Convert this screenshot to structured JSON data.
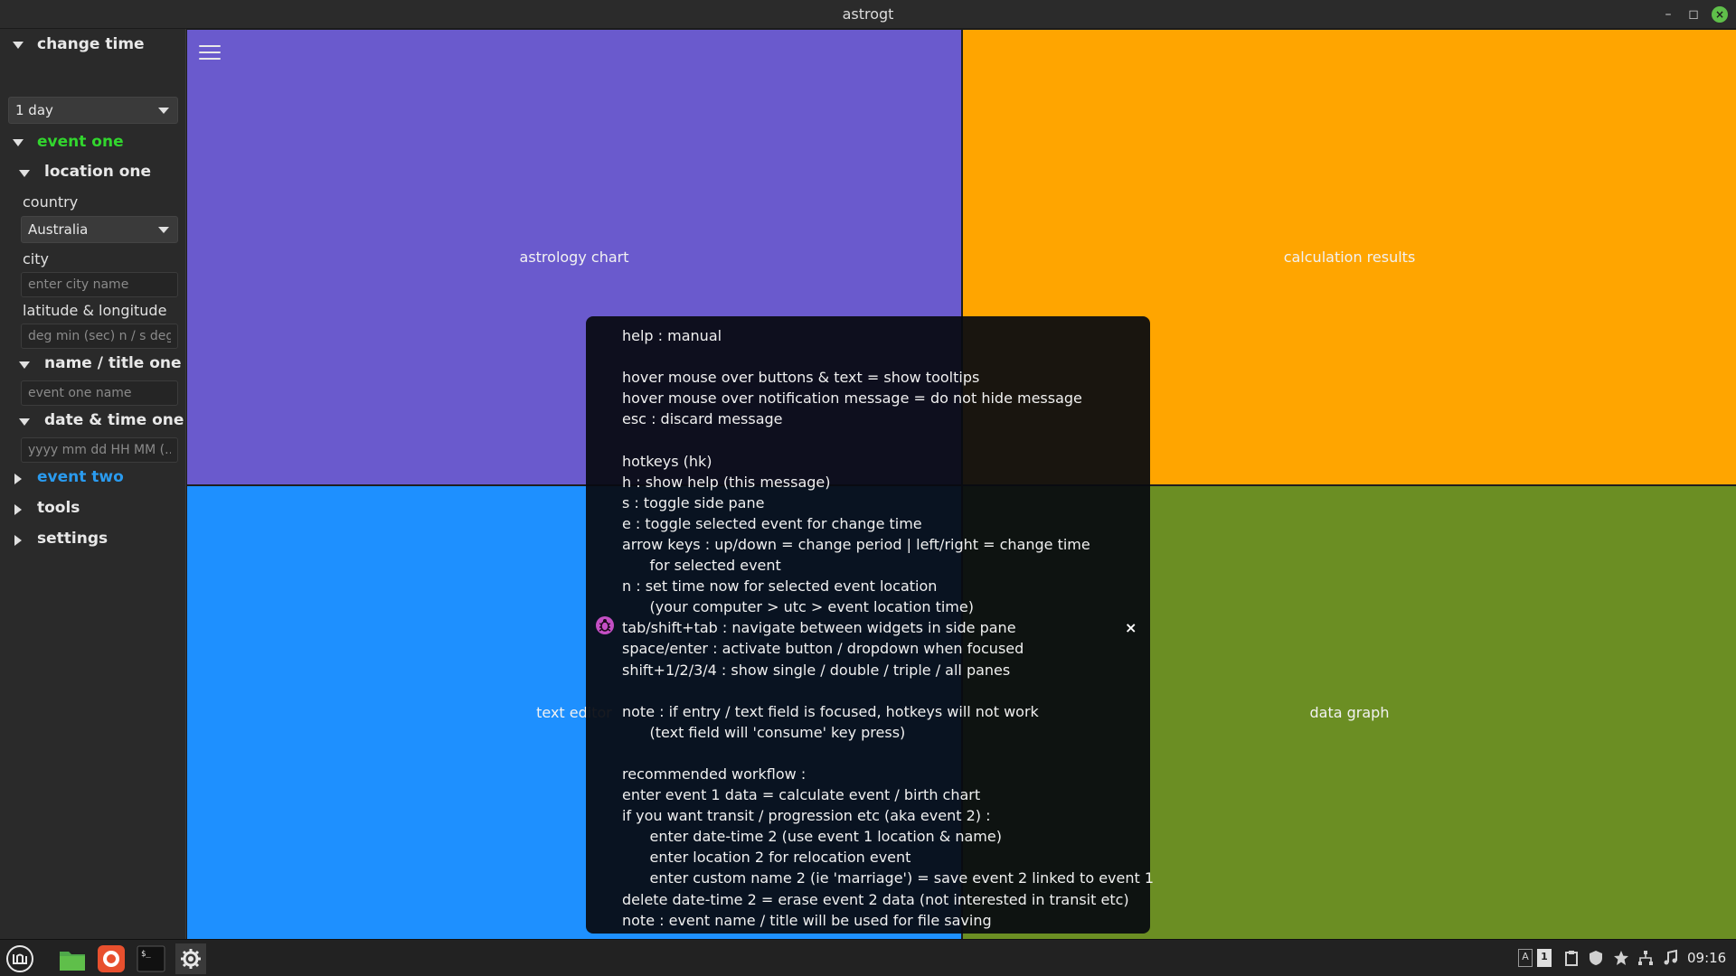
{
  "window": {
    "title": "astrogt"
  },
  "sidepane": {
    "change_time": {
      "header": "change time",
      "buttons": [
        "back-icon",
        "forward-icon",
        "now-clock-icon",
        "period-up-icon",
        "period-down-icon"
      ],
      "period": "1 day"
    },
    "event_one": {
      "header": "event one",
      "color": "#32d62e",
      "location": {
        "header": "location one",
        "country_label": "country",
        "country_value": "Australia",
        "city_label": "city",
        "city_placeholder": "enter city name",
        "latlong_label": "latitude & longitude",
        "latlong_placeholder": "deg min (sec) n / s deg..."
      },
      "name": {
        "header": "name / title one",
        "placeholder": "event one name"
      },
      "datetime": {
        "header": "date & time one",
        "placeholder": "yyyy mm dd HH MM (..."
      }
    },
    "event_two": {
      "header": "event two",
      "color": "#2a9bef"
    },
    "tools": {
      "header": "tools"
    },
    "settings": {
      "header": "settings"
    }
  },
  "panes": {
    "top_left": {
      "label": "astrology chart",
      "color": "#6a5acd"
    },
    "top_right": {
      "label": "calculation results",
      "color": "#ffa500"
    },
    "bottom_left": {
      "label": "text editor",
      "color": "#1e90ff"
    },
    "bottom_right": {
      "label": "data graph",
      "color": "#6b8e23"
    }
  },
  "help": {
    "lines": [
      "help : manual",
      "",
      "hover mouse over buttons & text = show tooltips",
      "hover mouse over notification message = do not hide message",
      "esc : discard message",
      "",
      "hotkeys (hk)",
      "h : show help (this message)",
      "s : toggle side pane",
      "e : toggle selected event for change time",
      "arrow keys : up/down = change period | left/right = change time",
      "      for selected event",
      "n : set time now for selected event location",
      "      (your computer > utc > event location time)",
      "tab/shift+tab : navigate between widgets in side pane",
      "space/enter : activate button / dropdown when focused",
      "shift+1/2/3/4 : show single / double / triple / all panes",
      "",
      "note : if entry / text field is focused, hotkeys will not work",
      "      (text field will 'consume' key press)",
      "",
      "recommended workflow :",
      "enter event 1 data = calculate event / birth chart",
      "if you want transit / progression etc (aka event 2) :",
      "      enter date-time 2 (use event 1 location & name)",
      "      enter location 2 for relocation event",
      "      enter custom name 2 (ie 'marriage') = save event 2 linked to event 1",
      "delete date-time 2 = erase event 2 data (not interested in transit etc)",
      "note : event name / title will be used for file saving"
    ],
    "close_label": "×",
    "icon": "bug-icon"
  },
  "taskbar": {
    "apps": [
      "mint-menu-icon",
      "files-icon",
      "firefox-icon",
      "terminal-icon",
      "settings-app-icon"
    ],
    "tray_keyboard": "A",
    "tray_workspace": "1",
    "clock": "09:16"
  }
}
